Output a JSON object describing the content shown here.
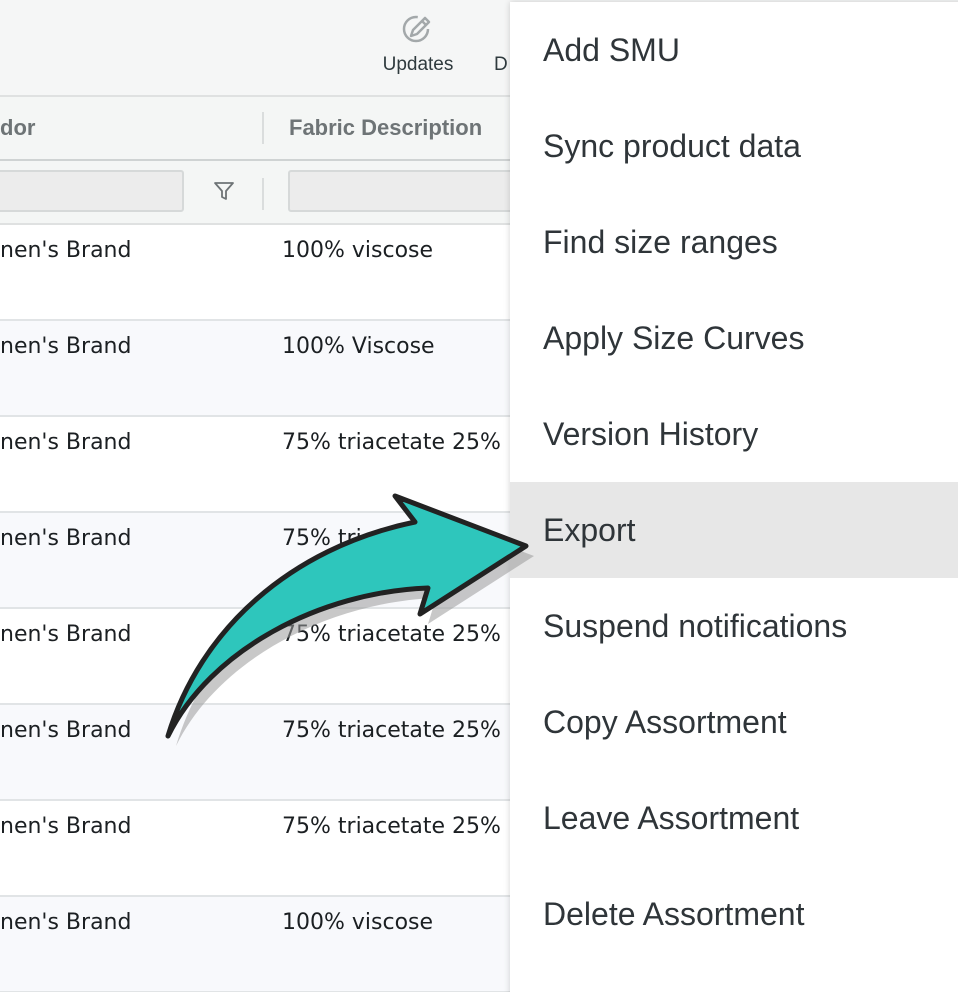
{
  "toolbar": {
    "updates": {
      "label": "Updates",
      "icon": "pencil-circle-icon"
    },
    "partial_label": "D"
  },
  "grid": {
    "columns": [
      "dor",
      "Fabric Description"
    ],
    "rows": [
      {
        "vendor": "nen's Brand",
        "fabric": "100% viscose"
      },
      {
        "vendor": "nen's Brand",
        "fabric": "100% Viscose"
      },
      {
        "vendor": "nen's Brand",
        "fabric": "75% triacetate 25%"
      },
      {
        "vendor": "nen's Brand",
        "fabric": "75% tri"
      },
      {
        "vendor": "nen's Brand",
        "fabric": "75% triacetate 25%"
      },
      {
        "vendor": "nen's Brand",
        "fabric": "75% triacetate 25%"
      },
      {
        "vendor": "nen's Brand",
        "fabric": "75% triacetate 25%"
      },
      {
        "vendor": "nen's Brand",
        "fabric": "100% viscose"
      }
    ]
  },
  "menu": {
    "items": [
      "Add SMU",
      "Sync product data",
      "Find size ranges",
      "Apply Size Curves",
      "Version History",
      "Export",
      "Suspend notifications",
      "Copy Assortment",
      "Leave Assortment",
      "Delete Assortment"
    ],
    "highlighted": "Export"
  },
  "colors": {
    "arrow_fill": "#2ec6bc",
    "arrow_stroke": "#222222",
    "highlight": "#e7e7e7"
  }
}
